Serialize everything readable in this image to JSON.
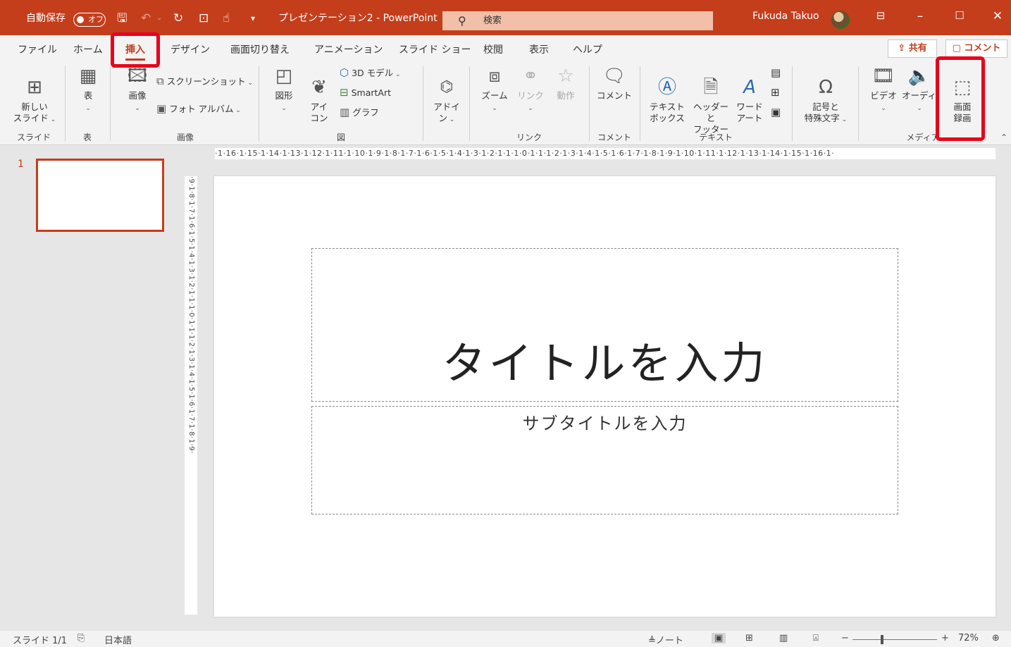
{
  "titlebar": {
    "autosave_label": "自動保存",
    "autosave_state": "オフ",
    "doc_title": "プレゼンテーション2 - PowerPoint",
    "search_placeholder": "検索",
    "user_name": "Fukuda Takuo",
    "icons": [
      "save-icon",
      "undo-icon",
      "redo-icon",
      "start-from-beginning-icon",
      "touch-mode-icon",
      "customize-qat-icon"
    ]
  },
  "tabs": [
    "ファイル",
    "ホーム",
    "挿入",
    "デザイン",
    "画面切り替え",
    "アニメーション",
    "スライド ショー",
    "校閲",
    "表示",
    "ヘルプ"
  ],
  "active_tab": "挿入",
  "share_label": "共有",
  "comment_label": "コメント",
  "ribbon": {
    "slides": {
      "new_slide": "新しい\nスライド",
      "group": "スライド"
    },
    "tables": {
      "table": "表",
      "group": "表"
    },
    "images": {
      "image": "画像",
      "screenshot": "スクリーンショット",
      "photo_album": "フォト アルバム",
      "group": "画像"
    },
    "illustrations": {
      "shapes": "図形",
      "icons": "アイ\nコン",
      "model3d": "3D モデル",
      "smartart": "SmartArt",
      "chart": "グラフ",
      "group": "図"
    },
    "addins": {
      "addins": "アドイ\nン"
    },
    "links": {
      "zoom": "ズーム",
      "link": "リンク",
      "action": "動作",
      "group": "リンク"
    },
    "comments": {
      "comment": "コメント",
      "group": "コメント"
    },
    "text": {
      "textbox": "テキスト\nボックス",
      "header_footer": "ヘッダーと\nフッター",
      "wordart": "ワード\nアート",
      "group": "テキスト"
    },
    "symbols": {
      "symbols": "記号と\n特殊文字"
    },
    "media": {
      "video": "ビデオ",
      "audio": "オーディオ",
      "screen_recording": "画面\n録画",
      "group": "メディア"
    }
  },
  "ruler": {
    "horizontal": "·1·16·1·15·1·14·1·13·1·12·1·11·1·10·1·9·1·8·1·7·1·6·1·5·1·4·1·3·1·2·1·1·1·0·1·1·1·2·1·3·1·4·1·5·1·6·1·7·1·8·1·9·1·10·1·11·1·12·1·13·1·14·1·15·1·16·1·",
    "vertical": "·9·1·8·1·7·1·6·1·5·1·4·1·3·1·2·1·1·1·0·1·1·1·2·1·3·1·4·1·5·1·6·1·7·1·8·1·9·"
  },
  "thumbnail_number": "1",
  "slide": {
    "title_placeholder": "タイトルを入力",
    "subtitle_placeholder": "サブタイトルを入力"
  },
  "statusbar": {
    "slide_info": "スライド 1/1",
    "language": "日本語",
    "notes_label": "ノート",
    "zoom_level": "72%",
    "zoom_minus": "−",
    "zoom_plus": "+"
  },
  "highlights": [
    "insert-tab",
    "screen-recording-button"
  ],
  "colors": {
    "accent": "#c43e1c",
    "highlight": "#e8001c"
  }
}
